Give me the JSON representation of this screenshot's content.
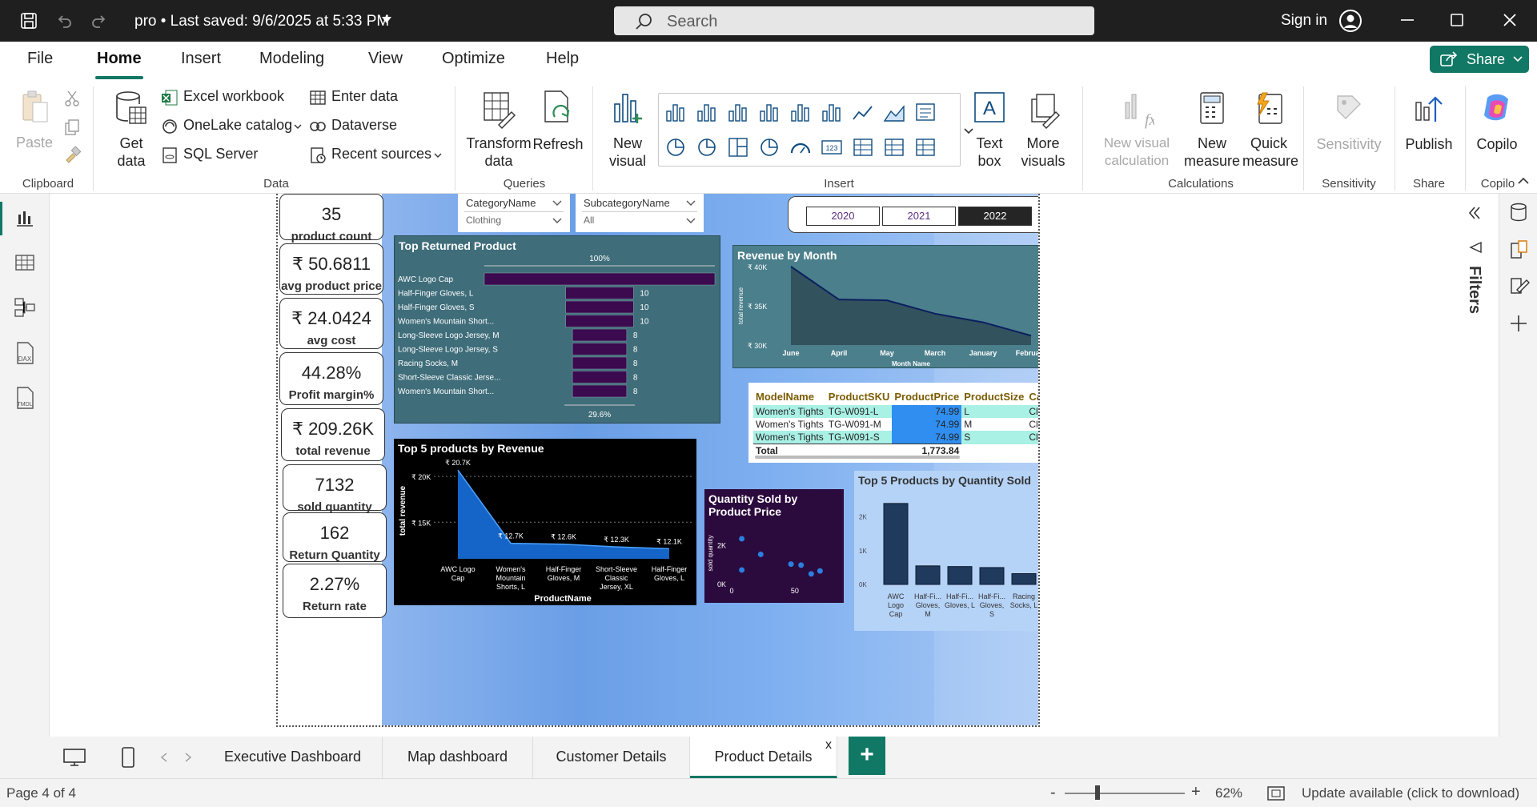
{
  "window": {
    "title": "pro • Last saved: 9/6/2025 at 5:33 PM",
    "search_placeholder": "Search",
    "signin": "Sign in"
  },
  "menu": {
    "items": [
      "File",
      "Home",
      "Insert",
      "Modeling",
      "View",
      "Optimize",
      "Help"
    ],
    "active": "Home",
    "share": "Share"
  },
  "ribbon": {
    "clipboard": {
      "paste": "Paste",
      "label": "Clipboard"
    },
    "data": {
      "get_data": "Get data",
      "excel": "Excel workbook",
      "onelake": "OneLake catalog",
      "sql": "SQL Server",
      "enter_data": "Enter data",
      "dataverse": "Dataverse",
      "recent": "Recent sources",
      "label": "Data"
    },
    "queries": {
      "transform": "Transform data",
      "refresh": "Refresh",
      "label": "Queries"
    },
    "insert": {
      "new_visual": "New visual",
      "text_box": "Text box",
      "more_visuals": "More visuals",
      "label": "Insert"
    },
    "calculations": {
      "new_visual_calc": "New visual calculation",
      "new_measure": "New measure",
      "quick_measure": "Quick measure",
      "label": "Calculations"
    },
    "sensitivity": {
      "btn": "Sensitivity",
      "label": "Sensitivity"
    },
    "share": {
      "publish": "Publish",
      "label": "Share"
    },
    "copilot": {
      "btn": "Copilo",
      "label": "Copilo"
    }
  },
  "kpis": [
    {
      "value": "35",
      "label": "product count"
    },
    {
      "value": "₹ 50.6811",
      "label": "avg product price"
    },
    {
      "value": "₹ 24.0424",
      "label": "avg cost"
    },
    {
      "value": "44.28%",
      "label": "Profit margin%"
    },
    {
      "value": "₹ 209.26K",
      "label": "total revenue"
    },
    {
      "value": "7132",
      "label": "sold quantity"
    },
    {
      "value": "162",
      "label": "Return Quantity"
    },
    {
      "value": "2.27%",
      "label": "Return rate"
    }
  ],
  "slicers": {
    "category": {
      "title": "CategoryName",
      "value": "Clothing"
    },
    "subcategory": {
      "title": "SubcategoryName",
      "value": "All"
    },
    "years": [
      "2020",
      "2021",
      "2022"
    ],
    "selected_year": "2022"
  },
  "chart_data": [
    {
      "type": "bar",
      "title": "Top Returned Product",
      "categories": [
        "AWC Logo Cap",
        "Half-Finger Gloves, L",
        "Half-Finger Gloves, S",
        "Women's Mountain Short...",
        "Long-Sleeve Logo Jersey, M",
        "Long-Sleeve Logo Jersey, S",
        "Racing Socks, M",
        "Short-Sleeve Classic Jerse...",
        "Women's Mountain Short..."
      ],
      "values": [
        34,
        10,
        10,
        10,
        8,
        8,
        8,
        8,
        8
      ],
      "data_labels": [
        "",
        "10",
        "10",
        "10",
        "8",
        "8",
        "8",
        "8",
        "8"
      ],
      "top_label": "100%",
      "bottom_label": "29.6%"
    },
    {
      "type": "area",
      "title": "Revenue by Month",
      "categories": [
        "June",
        "April",
        "May",
        "March",
        "January",
        "February"
      ],
      "values": [
        40000,
        35800,
        35700,
        34000,
        32900,
        31200
      ],
      "xlabel": "Month Name",
      "ylabel": "total revenue",
      "yticks": [
        "₹ 30K",
        "₹ 35K",
        "₹ 40K"
      ],
      "ylim": [
        30000,
        40000
      ]
    },
    {
      "type": "area",
      "title": "Top 5 products by Revenue",
      "categories": [
        "AWC Logo Cap",
        "Women's Mountain Shorts, L",
        "Half-Finger Gloves, M",
        "Short-Sleeve Classic Jersey, XL",
        "Half-Finger Gloves, L"
      ],
      "values": [
        20700,
        12700,
        12600,
        12300,
        12100
      ],
      "data_labels": [
        "₹ 20.7K",
        "₹ 12.7K",
        "₹ 12.6K",
        "₹ 12.3K",
        "₹ 12.1K"
      ],
      "xlabel": "ProductName",
      "ylabel": "total revenue",
      "yticks": [
        "₹ 15K",
        "₹ 20K"
      ],
      "ylim": [
        11000,
        21500
      ]
    },
    {
      "type": "scatter",
      "title": "Quantity Sold by Product Price",
      "ylabel": "sold quantity",
      "xticks": [
        "0",
        "50"
      ],
      "yticks": [
        "0K",
        "2K"
      ],
      "points": [
        [
          8,
          2300
        ],
        [
          23,
          1500
        ],
        [
          8,
          700
        ],
        [
          47,
          1000
        ],
        [
          55,
          950
        ],
        [
          63,
          500
        ],
        [
          70,
          650
        ]
      ],
      "xlim": [
        0,
        85
      ],
      "ylim": [
        0,
        3200
      ]
    },
    {
      "type": "bar",
      "title": "Top 5 Products by Quantity Sold",
      "categories": [
        "AWC Logo Cap",
        "Half-Fi... Gloves, M",
        "Half-Fi... Gloves, L",
        "Half-Fi... Gloves, S",
        "Racing Socks, L"
      ],
      "values": [
        2400,
        550,
        530,
        500,
        320
      ],
      "yticks": [
        "0K",
        "1K",
        "2K"
      ],
      "ylim": [
        0,
        2800
      ]
    }
  ],
  "table": {
    "columns": [
      "ModelName",
      "ProductSKU",
      "ProductPrice",
      "ProductSize",
      "Catego"
    ],
    "rows": [
      [
        "Women's Tights",
        "TG-W091-L",
        "74.99",
        "L",
        "Clothing"
      ],
      [
        "Women's Tights",
        "TG-W091-M",
        "74.99",
        "M",
        "Clothing"
      ],
      [
        "Women's Tights",
        "TG-W091-S",
        "74.99",
        "S",
        "Clothing"
      ]
    ],
    "total_label": "Total",
    "total_value": "1,773.84"
  },
  "right_pane": {
    "filters": "Filters"
  },
  "pages": {
    "tabs": [
      "Executive Dashboard",
      "Map dashboard",
      "Customer Details",
      "Product Details"
    ],
    "active": "Product Details",
    "close": "x",
    "add": "+"
  },
  "status": {
    "page": "Page 4 of 4",
    "zoom": "62%",
    "update": "Update available (click to download)"
  }
}
